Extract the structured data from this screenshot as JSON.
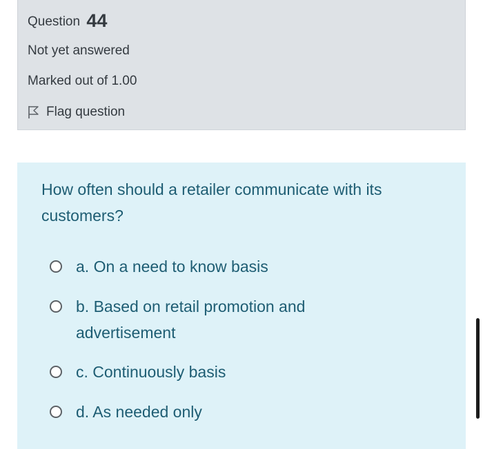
{
  "info": {
    "question_word": "Question",
    "question_number": "44",
    "status": "Not yet answered",
    "marks": "Marked out of 1.00",
    "flag_label": "Flag question",
    "flag_icon": "flag-icon"
  },
  "question": {
    "text": "How often should a retailer communicate with its customers?",
    "answers": [
      {
        "label": "a. On a need to know basis",
        "selected": false
      },
      {
        "label": "b. Based on retail promotion and advertisement",
        "selected": false
      },
      {
        "label": "c. Continuously basis",
        "selected": false
      },
      {
        "label": "d. As needed only",
        "selected": false
      }
    ]
  },
  "colors": {
    "info_bg": "#dee2e6",
    "content_bg": "#def2f8",
    "question_text": "#1e5d73",
    "info_text": "#343a40"
  }
}
